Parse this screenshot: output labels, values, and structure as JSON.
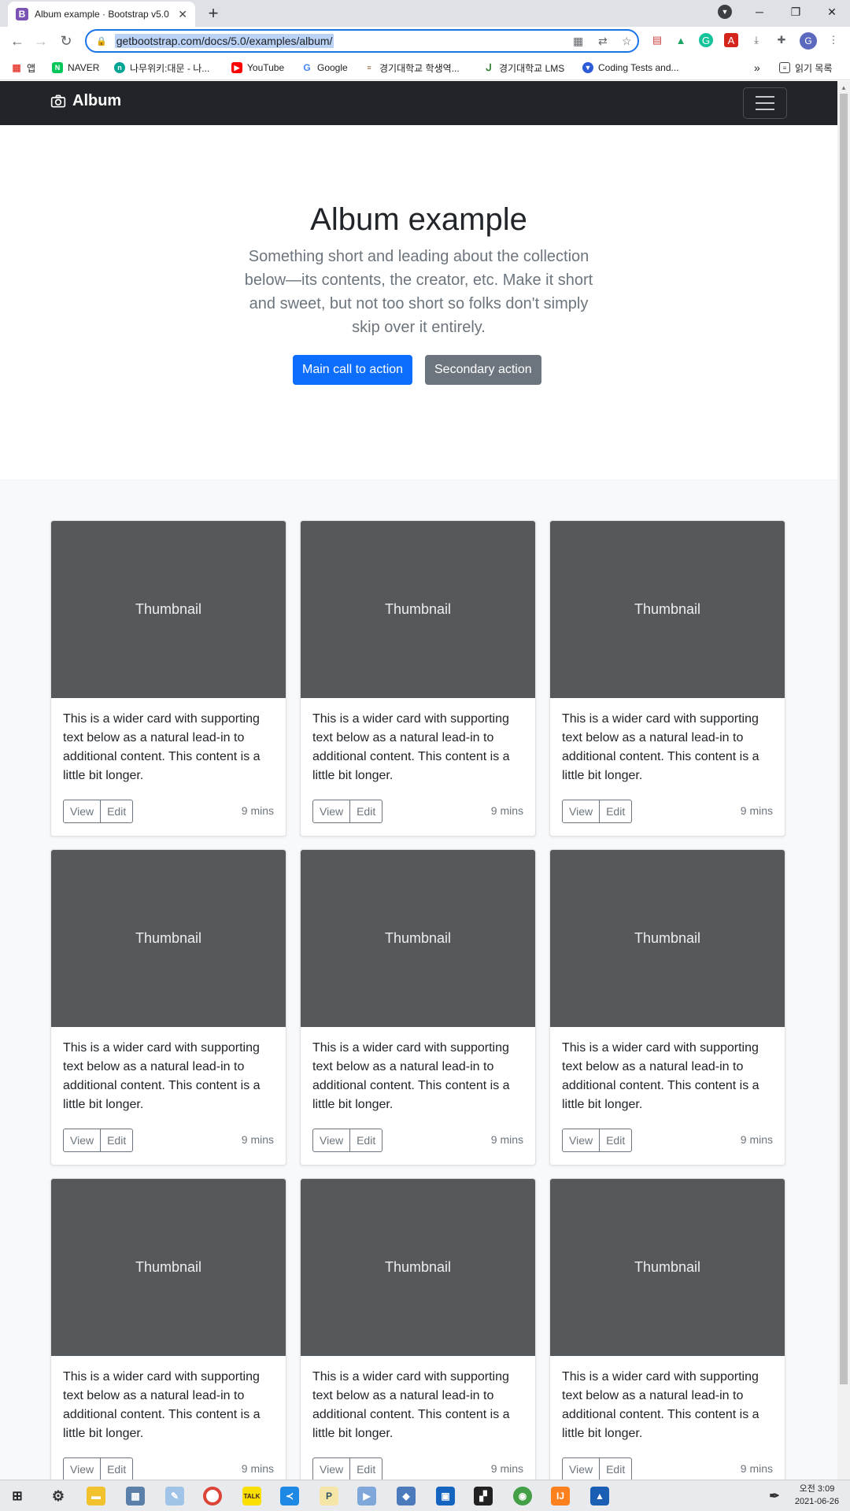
{
  "browser": {
    "tab_title": "Album example · Bootstrap v5.0",
    "tab_icon_letter": "B",
    "new_tab": "+",
    "url": "getbootstrap.com/docs/5.0/examples/album/",
    "profile_letter": "G",
    "bookmarks": [
      {
        "label": "앱",
        "icon": "apps-grid-icon"
      },
      {
        "label": "NAVER",
        "icon": "naver-icon"
      },
      {
        "label": "나무위키:대문 - 나...",
        "icon": "namuwiki-icon"
      },
      {
        "label": "YouTube",
        "icon": "youtube-icon"
      },
      {
        "label": "Google",
        "icon": "google-icon"
      },
      {
        "label": "경기대학교 학생역...",
        "icon": "kyonggi-icon"
      },
      {
        "label": "경기대학교 LMS",
        "icon": "lms-icon"
      },
      {
        "label": "Coding Tests and...",
        "icon": "coding-icon"
      }
    ],
    "bookmarks_more": "»",
    "reading_list": "읽기 목록"
  },
  "page": {
    "brand": "Album",
    "hero_title": "Album example",
    "hero_lead": "Something short and leading about the collection below—its contents, the creator, etc. Make it short and sweet, but not too short so folks don't simply skip over it entirely.",
    "primary_button": "Main call to action",
    "secondary_button": "Secondary action",
    "cards": [
      {
        "thumb": "Thumbnail",
        "text": "This is a wider card with supporting text below as a natural lead-in to additional content. This content is a little bit longer.",
        "view": "View",
        "edit": "Edit",
        "time": "9 mins"
      },
      {
        "thumb": "Thumbnail",
        "text": "This is a wider card with supporting text below as a natural lead-in to additional content. This content is a little bit longer.",
        "view": "View",
        "edit": "Edit",
        "time": "9 mins"
      },
      {
        "thumb": "Thumbnail",
        "text": "This is a wider card with supporting text below as a natural lead-in to additional content. This content is a little bit longer.",
        "view": "View",
        "edit": "Edit",
        "time": "9 mins"
      },
      {
        "thumb": "Thumbnail",
        "text": "This is a wider card with supporting text below as a natural lead-in to additional content. This content is a little bit longer.",
        "view": "View",
        "edit": "Edit",
        "time": "9 mins"
      },
      {
        "thumb": "Thumbnail",
        "text": "This is a wider card with supporting text below as a natural lead-in to additional content. This content is a little bit longer.",
        "view": "View",
        "edit": "Edit",
        "time": "9 mins"
      },
      {
        "thumb": "Thumbnail",
        "text": "This is a wider card with supporting text below as a natural lead-in to additional content. This content is a little bit longer.",
        "view": "View",
        "edit": "Edit",
        "time": "9 mins"
      },
      {
        "thumb": "Thumbnail",
        "text": "This is a wider card with supporting text below as a natural lead-in to additional content. This content is a little bit longer.",
        "view": "View",
        "edit": "Edit",
        "time": "9 mins"
      },
      {
        "thumb": "Thumbnail",
        "text": "This is a wider card with supporting text below as a natural lead-in to additional content. This content is a little bit longer.",
        "view": "View",
        "edit": "Edit",
        "time": "9 mins"
      },
      {
        "thumb": "Thumbnail",
        "text": "This is a wider card with supporting text below as a natural lead-in to additional content. This content is a little bit longer.",
        "view": "View",
        "edit": "Edit",
        "time": "9 mins"
      }
    ]
  },
  "taskbar": {
    "clock_time": "오전 3:09",
    "clock_date": "2021-06-26"
  },
  "colors": {
    "primary": "#0d6efd",
    "secondary": "#6c757d",
    "navbar": "#212529",
    "thumbnail": "#55595c",
    "album_bg": "#f8f9fa"
  }
}
